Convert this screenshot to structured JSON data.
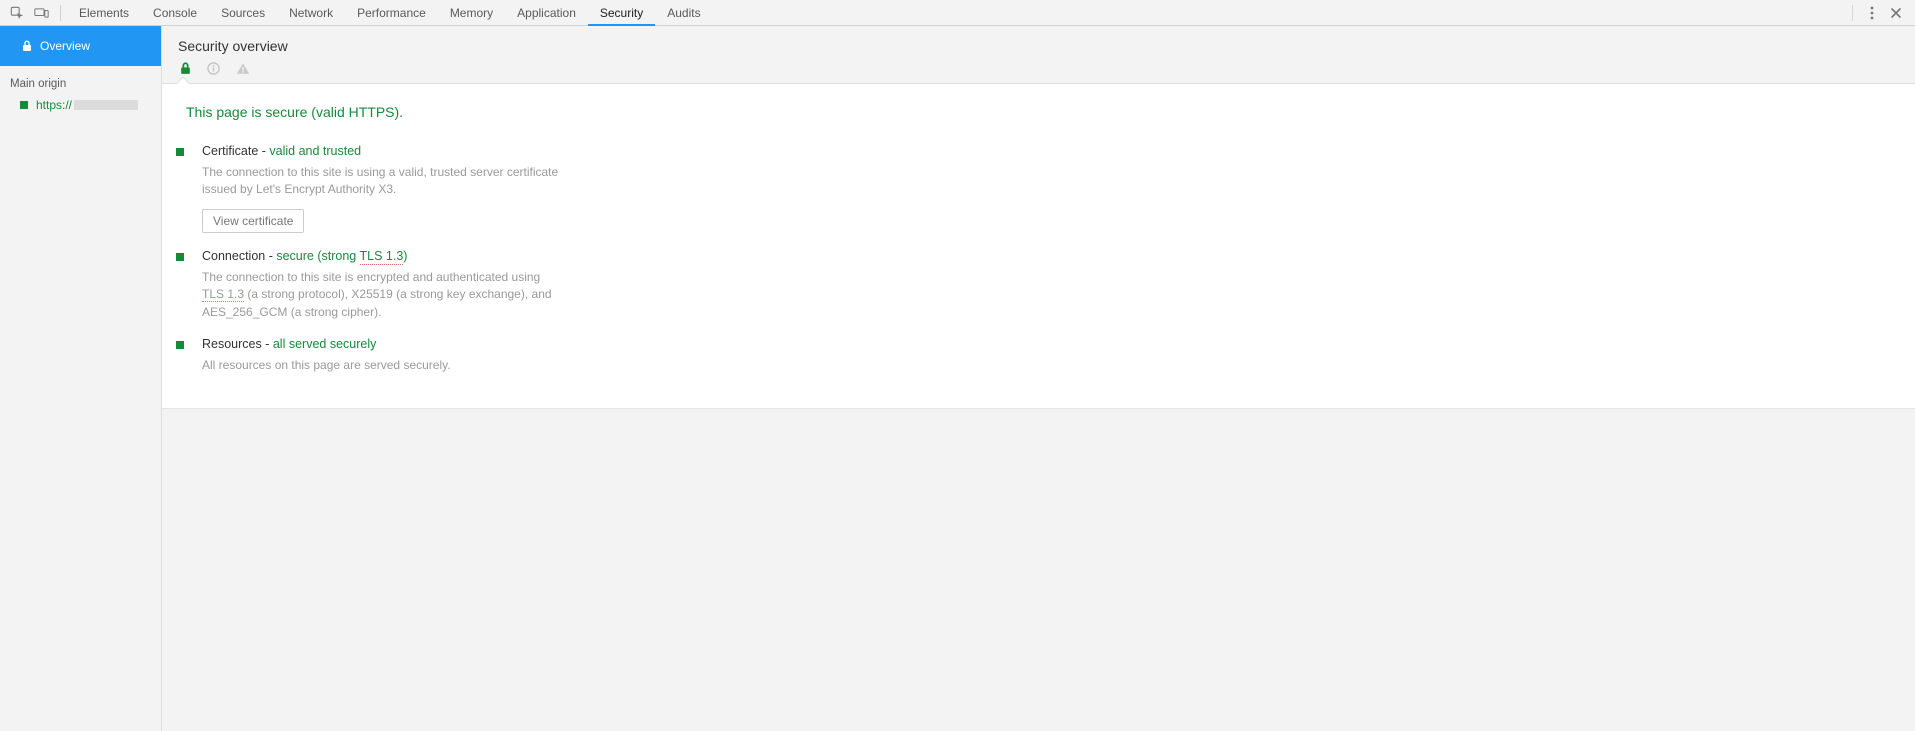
{
  "tabs": {
    "items": [
      {
        "label": "Elements",
        "active": false
      },
      {
        "label": "Console",
        "active": false
      },
      {
        "label": "Sources",
        "active": false
      },
      {
        "label": "Network",
        "active": false
      },
      {
        "label": "Performance",
        "active": false
      },
      {
        "label": "Memory",
        "active": false
      },
      {
        "label": "Application",
        "active": false
      },
      {
        "label": "Security",
        "active": true
      },
      {
        "label": "Audits",
        "active": false
      }
    ]
  },
  "sidebar": {
    "overview_label": "Overview",
    "section_label": "Main origin",
    "origin_prefix": "https://"
  },
  "overview": {
    "title": "Security overview",
    "headline": "This page is secure (valid HTTPS).",
    "certificate": {
      "lead": "Certificate",
      "dash": " - ",
      "status": "valid and trusted",
      "desc": "The connection to this site is using a valid, trusted server certificate issued by Let's Encrypt Authority X3.",
      "button": "View certificate"
    },
    "connection": {
      "lead": "Connection",
      "dash": " - ",
      "status_pre": "secure (strong ",
      "status_tls": "TLS 1.3",
      "status_post": ")",
      "desc_pre": "The connection to this site is encrypted and authenticated using ",
      "desc_tls": "TLS 1.3",
      "desc_post": " (a strong protocol), X25519 (a strong key exchange), and AES_256_GCM (a strong cipher)."
    },
    "resources": {
      "lead": "Resources",
      "dash": " - ",
      "status": "all served securely",
      "desc": "All resources on this page are served securely."
    }
  }
}
